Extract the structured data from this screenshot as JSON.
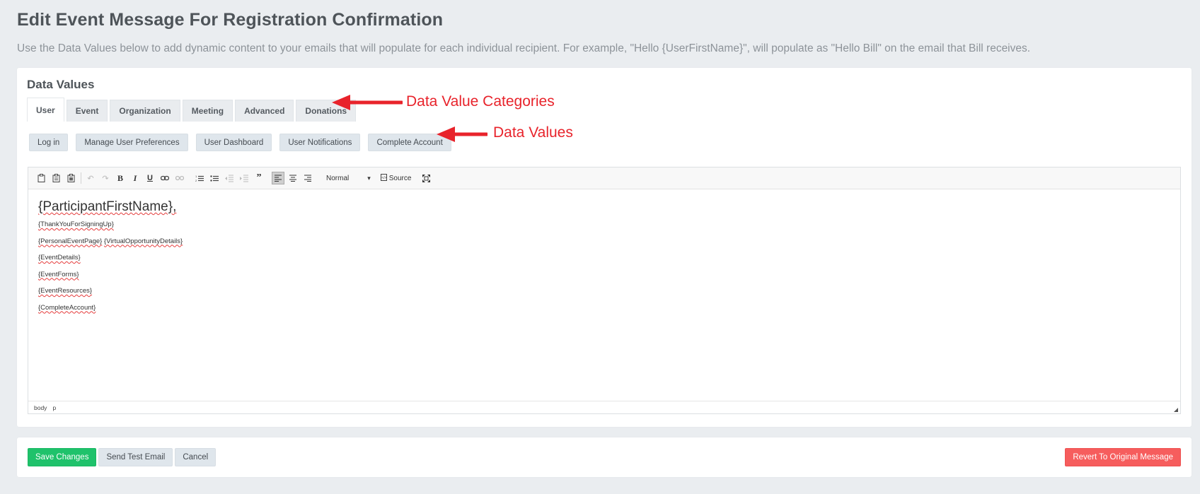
{
  "page": {
    "title": "Edit Event Message For Registration Confirmation",
    "description": "Use the Data Values below to add dynamic content to your emails that will populate for each individual recipient. For example, \"Hello {UserFirstName}\", will populate as \"Hello Bill\" on the email that Bill receives."
  },
  "data_values": {
    "section_title": "Data Values",
    "tabs": [
      {
        "label": "User",
        "active": true
      },
      {
        "label": "Event",
        "active": false
      },
      {
        "label": "Organization",
        "active": false
      },
      {
        "label": "Meeting",
        "active": false
      },
      {
        "label": "Advanced",
        "active": false
      },
      {
        "label": "Donations",
        "active": false
      }
    ],
    "buttons": [
      "Log in",
      "Manage User Preferences",
      "User Dashboard",
      "User Notifications",
      "Complete Account"
    ]
  },
  "annotations": {
    "categories_label": "Data Value Categories",
    "values_label": "Data Values",
    "color": "#e8232b"
  },
  "editor": {
    "toolbar": {
      "icons": [
        "paste-icon",
        "paste-text-icon",
        "paste-word-icon",
        "undo-icon",
        "redo-icon",
        "bold-icon",
        "italic-icon",
        "underline-icon",
        "link-icon",
        "unlink-icon",
        "numbered-list-icon",
        "bulleted-list-icon",
        "decrease-indent-icon",
        "increase-indent-icon",
        "blockquote-icon",
        "align-left-icon",
        "align-center-icon",
        "align-right-icon",
        "source-icon",
        "maximize-icon"
      ],
      "format_value": "Normal",
      "source_label": "Source"
    },
    "content": {
      "greeting": "{ParticipantFirstName},",
      "thank_you": "{ThankYouForSigningUp}",
      "personal_event_page": "{PersonalEventPage}",
      "virtual_opportunity_details": "{VirtualOpportunityDetails}",
      "event_details": "{EventDetails}",
      "event_forms": "{EventForms}",
      "event_resources": "{EventResources}",
      "complete_account": "{CompleteAccount}"
    },
    "status_path": [
      "body",
      "p"
    ]
  },
  "footer": {
    "save_label": "Save Changes",
    "test_label": "Send Test Email",
    "cancel_label": "Cancel",
    "revert_label": "Revert To Original Message"
  },
  "colors": {
    "save": "#1fc26b",
    "revert": "#f65d5d",
    "neutral_button": "#dfe6ec",
    "background": "#eaedf0"
  }
}
